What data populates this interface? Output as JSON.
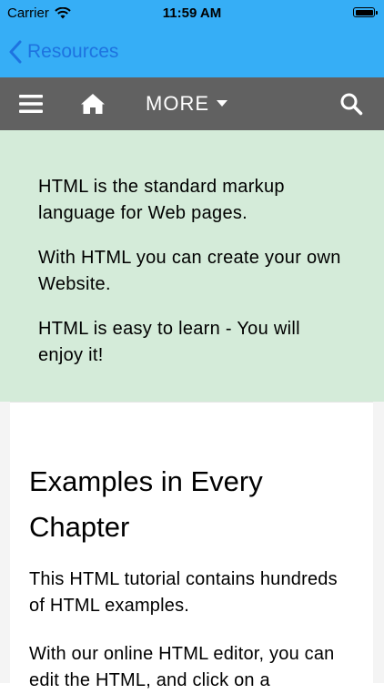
{
  "status_bar": {
    "carrier": "Carrier",
    "time": "11:59 AM"
  },
  "nav": {
    "back_label": "Resources"
  },
  "toolbar": {
    "more_label": "MORE"
  },
  "intro": {
    "paragraphs": [
      "HTML is the standard markup language for Web pages.",
      "With HTML you can create your own Website.",
      "HTML is easy to learn - You will enjoy it!"
    ]
  },
  "section": {
    "heading": "Examples in Every Chapter",
    "p1": "This HTML tutorial contains hundreds of HTML examples.",
    "p2": "With our online HTML editor, you can edit the HTML, and click on a"
  },
  "colors": {
    "header_blue": "#36aef6",
    "toolbar_gray": "#616161",
    "intro_green": "#d4ebd9",
    "link_blue": "#1e73e0"
  }
}
